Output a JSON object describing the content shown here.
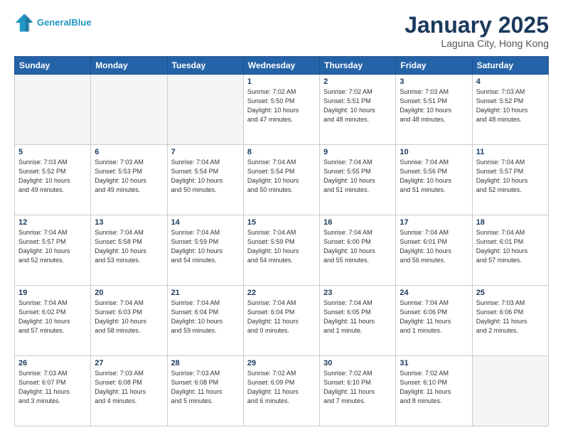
{
  "header": {
    "logo_line1": "General",
    "logo_line2": "Blue",
    "title": "January 2025",
    "subtitle": "Laguna City, Hong Kong"
  },
  "weekdays": [
    "Sunday",
    "Monday",
    "Tuesday",
    "Wednesday",
    "Thursday",
    "Friday",
    "Saturday"
  ],
  "weeks": [
    [
      {
        "day": "",
        "info": ""
      },
      {
        "day": "",
        "info": ""
      },
      {
        "day": "",
        "info": ""
      },
      {
        "day": "1",
        "info": "Sunrise: 7:02 AM\nSunset: 5:50 PM\nDaylight: 10 hours\nand 47 minutes."
      },
      {
        "day": "2",
        "info": "Sunrise: 7:02 AM\nSunset: 5:51 PM\nDaylight: 10 hours\nand 48 minutes."
      },
      {
        "day": "3",
        "info": "Sunrise: 7:03 AM\nSunset: 5:51 PM\nDaylight: 10 hours\nand 48 minutes."
      },
      {
        "day": "4",
        "info": "Sunrise: 7:03 AM\nSunset: 5:52 PM\nDaylight: 10 hours\nand 48 minutes."
      }
    ],
    [
      {
        "day": "5",
        "info": "Sunrise: 7:03 AM\nSunset: 5:52 PM\nDaylight: 10 hours\nand 49 minutes."
      },
      {
        "day": "6",
        "info": "Sunrise: 7:03 AM\nSunset: 5:53 PM\nDaylight: 10 hours\nand 49 minutes."
      },
      {
        "day": "7",
        "info": "Sunrise: 7:04 AM\nSunset: 5:54 PM\nDaylight: 10 hours\nand 50 minutes."
      },
      {
        "day": "8",
        "info": "Sunrise: 7:04 AM\nSunset: 5:54 PM\nDaylight: 10 hours\nand 50 minutes."
      },
      {
        "day": "9",
        "info": "Sunrise: 7:04 AM\nSunset: 5:55 PM\nDaylight: 10 hours\nand 51 minutes."
      },
      {
        "day": "10",
        "info": "Sunrise: 7:04 AM\nSunset: 5:56 PM\nDaylight: 10 hours\nand 51 minutes."
      },
      {
        "day": "11",
        "info": "Sunrise: 7:04 AM\nSunset: 5:57 PM\nDaylight: 10 hours\nand 52 minutes."
      }
    ],
    [
      {
        "day": "12",
        "info": "Sunrise: 7:04 AM\nSunset: 5:57 PM\nDaylight: 10 hours\nand 52 minutes."
      },
      {
        "day": "13",
        "info": "Sunrise: 7:04 AM\nSunset: 5:58 PM\nDaylight: 10 hours\nand 53 minutes."
      },
      {
        "day": "14",
        "info": "Sunrise: 7:04 AM\nSunset: 5:59 PM\nDaylight: 10 hours\nand 54 minutes."
      },
      {
        "day": "15",
        "info": "Sunrise: 7:04 AM\nSunset: 5:59 PM\nDaylight: 10 hours\nand 54 minutes."
      },
      {
        "day": "16",
        "info": "Sunrise: 7:04 AM\nSunset: 6:00 PM\nDaylight: 10 hours\nand 55 minutes."
      },
      {
        "day": "17",
        "info": "Sunrise: 7:04 AM\nSunset: 6:01 PM\nDaylight: 10 hours\nand 56 minutes."
      },
      {
        "day": "18",
        "info": "Sunrise: 7:04 AM\nSunset: 6:01 PM\nDaylight: 10 hours\nand 57 minutes."
      }
    ],
    [
      {
        "day": "19",
        "info": "Sunrise: 7:04 AM\nSunset: 6:02 PM\nDaylight: 10 hours\nand 57 minutes."
      },
      {
        "day": "20",
        "info": "Sunrise: 7:04 AM\nSunset: 6:03 PM\nDaylight: 10 hours\nand 58 minutes."
      },
      {
        "day": "21",
        "info": "Sunrise: 7:04 AM\nSunset: 6:04 PM\nDaylight: 10 hours\nand 59 minutes."
      },
      {
        "day": "22",
        "info": "Sunrise: 7:04 AM\nSunset: 6:04 PM\nDaylight: 11 hours\nand 0 minutes."
      },
      {
        "day": "23",
        "info": "Sunrise: 7:04 AM\nSunset: 6:05 PM\nDaylight: 11 hours\nand 1 minute."
      },
      {
        "day": "24",
        "info": "Sunrise: 7:04 AM\nSunset: 6:06 PM\nDaylight: 11 hours\nand 1 minutes."
      },
      {
        "day": "25",
        "info": "Sunrise: 7:03 AM\nSunset: 6:06 PM\nDaylight: 11 hours\nand 2 minutes."
      }
    ],
    [
      {
        "day": "26",
        "info": "Sunrise: 7:03 AM\nSunset: 6:07 PM\nDaylight: 11 hours\nand 3 minutes."
      },
      {
        "day": "27",
        "info": "Sunrise: 7:03 AM\nSunset: 6:08 PM\nDaylight: 11 hours\nand 4 minutes."
      },
      {
        "day": "28",
        "info": "Sunrise: 7:03 AM\nSunset: 6:08 PM\nDaylight: 11 hours\nand 5 minutes."
      },
      {
        "day": "29",
        "info": "Sunrise: 7:02 AM\nSunset: 6:09 PM\nDaylight: 11 hours\nand 6 minutes."
      },
      {
        "day": "30",
        "info": "Sunrise: 7:02 AM\nSunset: 6:10 PM\nDaylight: 11 hours\nand 7 minutes."
      },
      {
        "day": "31",
        "info": "Sunrise: 7:02 AM\nSunset: 6:10 PM\nDaylight: 11 hours\nand 8 minutes."
      },
      {
        "day": "",
        "info": ""
      }
    ]
  ]
}
